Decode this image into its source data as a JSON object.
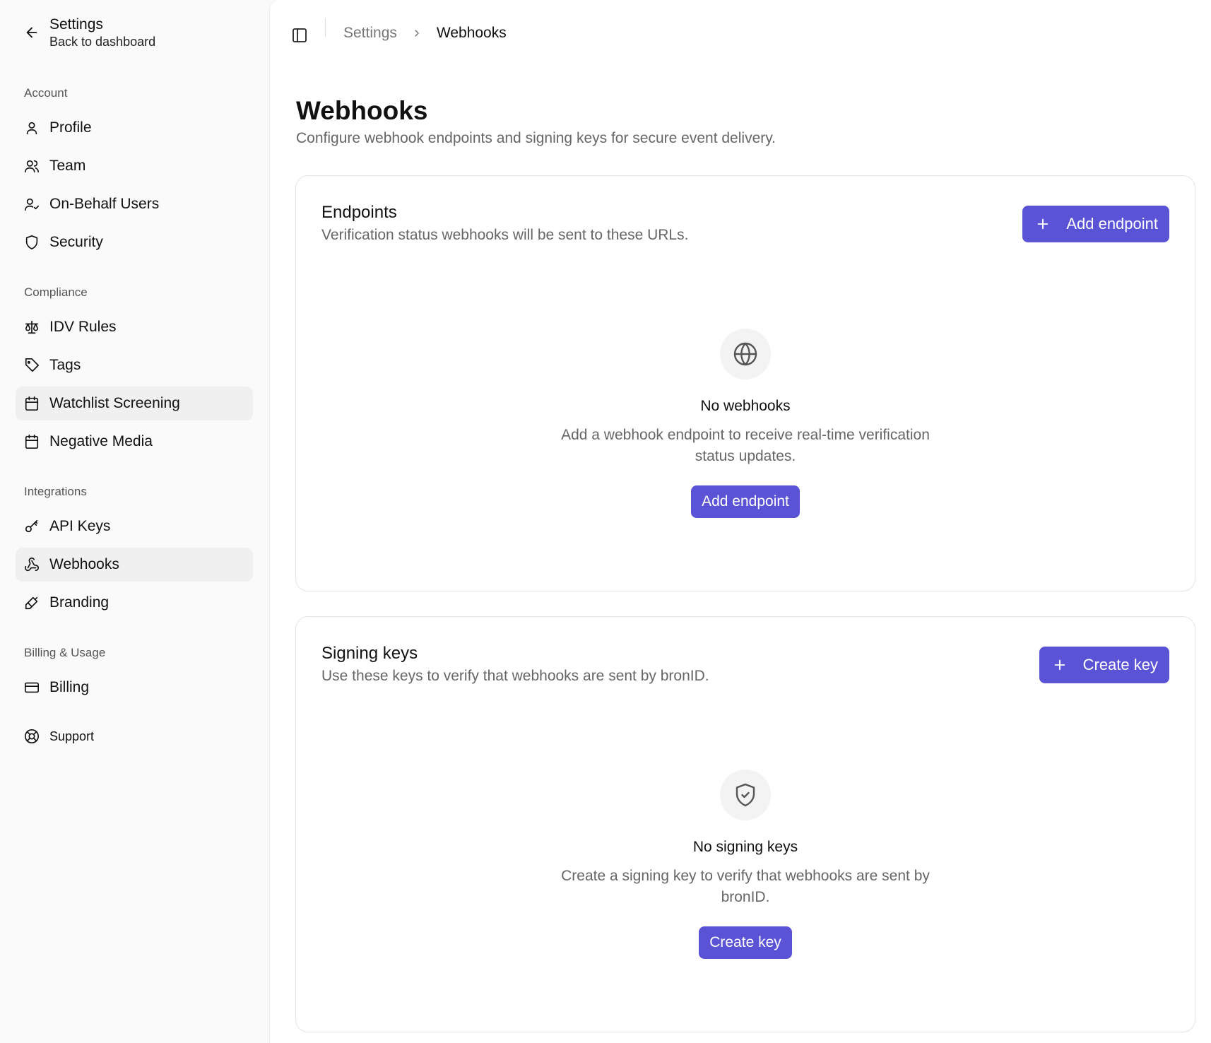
{
  "sidebar": {
    "back": {
      "title": "Settings",
      "subtitle": "Back to dashboard"
    },
    "groups": [
      {
        "label": "Account"
      },
      {
        "label": "Compliance"
      },
      {
        "label": "Integrations"
      },
      {
        "label": "Billing & Usage"
      }
    ],
    "items": [
      {
        "label": "Profile",
        "icon": "user-icon"
      },
      {
        "label": "Team",
        "icon": "users-icon"
      },
      {
        "label": "On-Behalf Users",
        "icon": "user-check-icon"
      },
      {
        "label": "Security",
        "icon": "shield-icon"
      },
      {
        "label": "IDV Rules",
        "icon": "scale-icon"
      },
      {
        "label": "Tags",
        "icon": "tag-icon"
      },
      {
        "label": "Watchlist Screening",
        "icon": "calendar-icon"
      },
      {
        "label": "Negative Media",
        "icon": "calendar-icon"
      },
      {
        "label": "API Keys",
        "icon": "key-icon"
      },
      {
        "label": "Webhooks",
        "icon": "webhook-icon",
        "active": true
      },
      {
        "label": "Branding",
        "icon": "brush-icon"
      },
      {
        "label": "Billing",
        "icon": "credit-card-icon"
      },
      {
        "label": "Support",
        "icon": "life-buoy-icon"
      }
    ]
  },
  "breadcrumb": {
    "parent": "Settings",
    "current": "Webhooks"
  },
  "page": {
    "title": "Webhooks",
    "subtitle": "Configure webhook endpoints and signing keys for secure event delivery."
  },
  "endpoints": {
    "title": "Endpoints",
    "subtitle": "Verification status webhooks will be sent to these URLs.",
    "add_label": "Add endpoint",
    "empty_title": "No webhooks",
    "empty_desc": "Add a webhook endpoint to receive real-time verification status updates.",
    "empty_button": "Add endpoint"
  },
  "signing": {
    "title": "Signing keys",
    "subtitle": "Use these keys to verify that webhooks are sent by bronID.",
    "create_label": "Create key",
    "empty_title": "No signing keys",
    "empty_desc": "Create a signing key to verify that webhooks are sent by bronID.",
    "empty_button": "Create key"
  },
  "colors": {
    "accent": "#5a53d6",
    "active_bg": "#f0f0f0"
  }
}
